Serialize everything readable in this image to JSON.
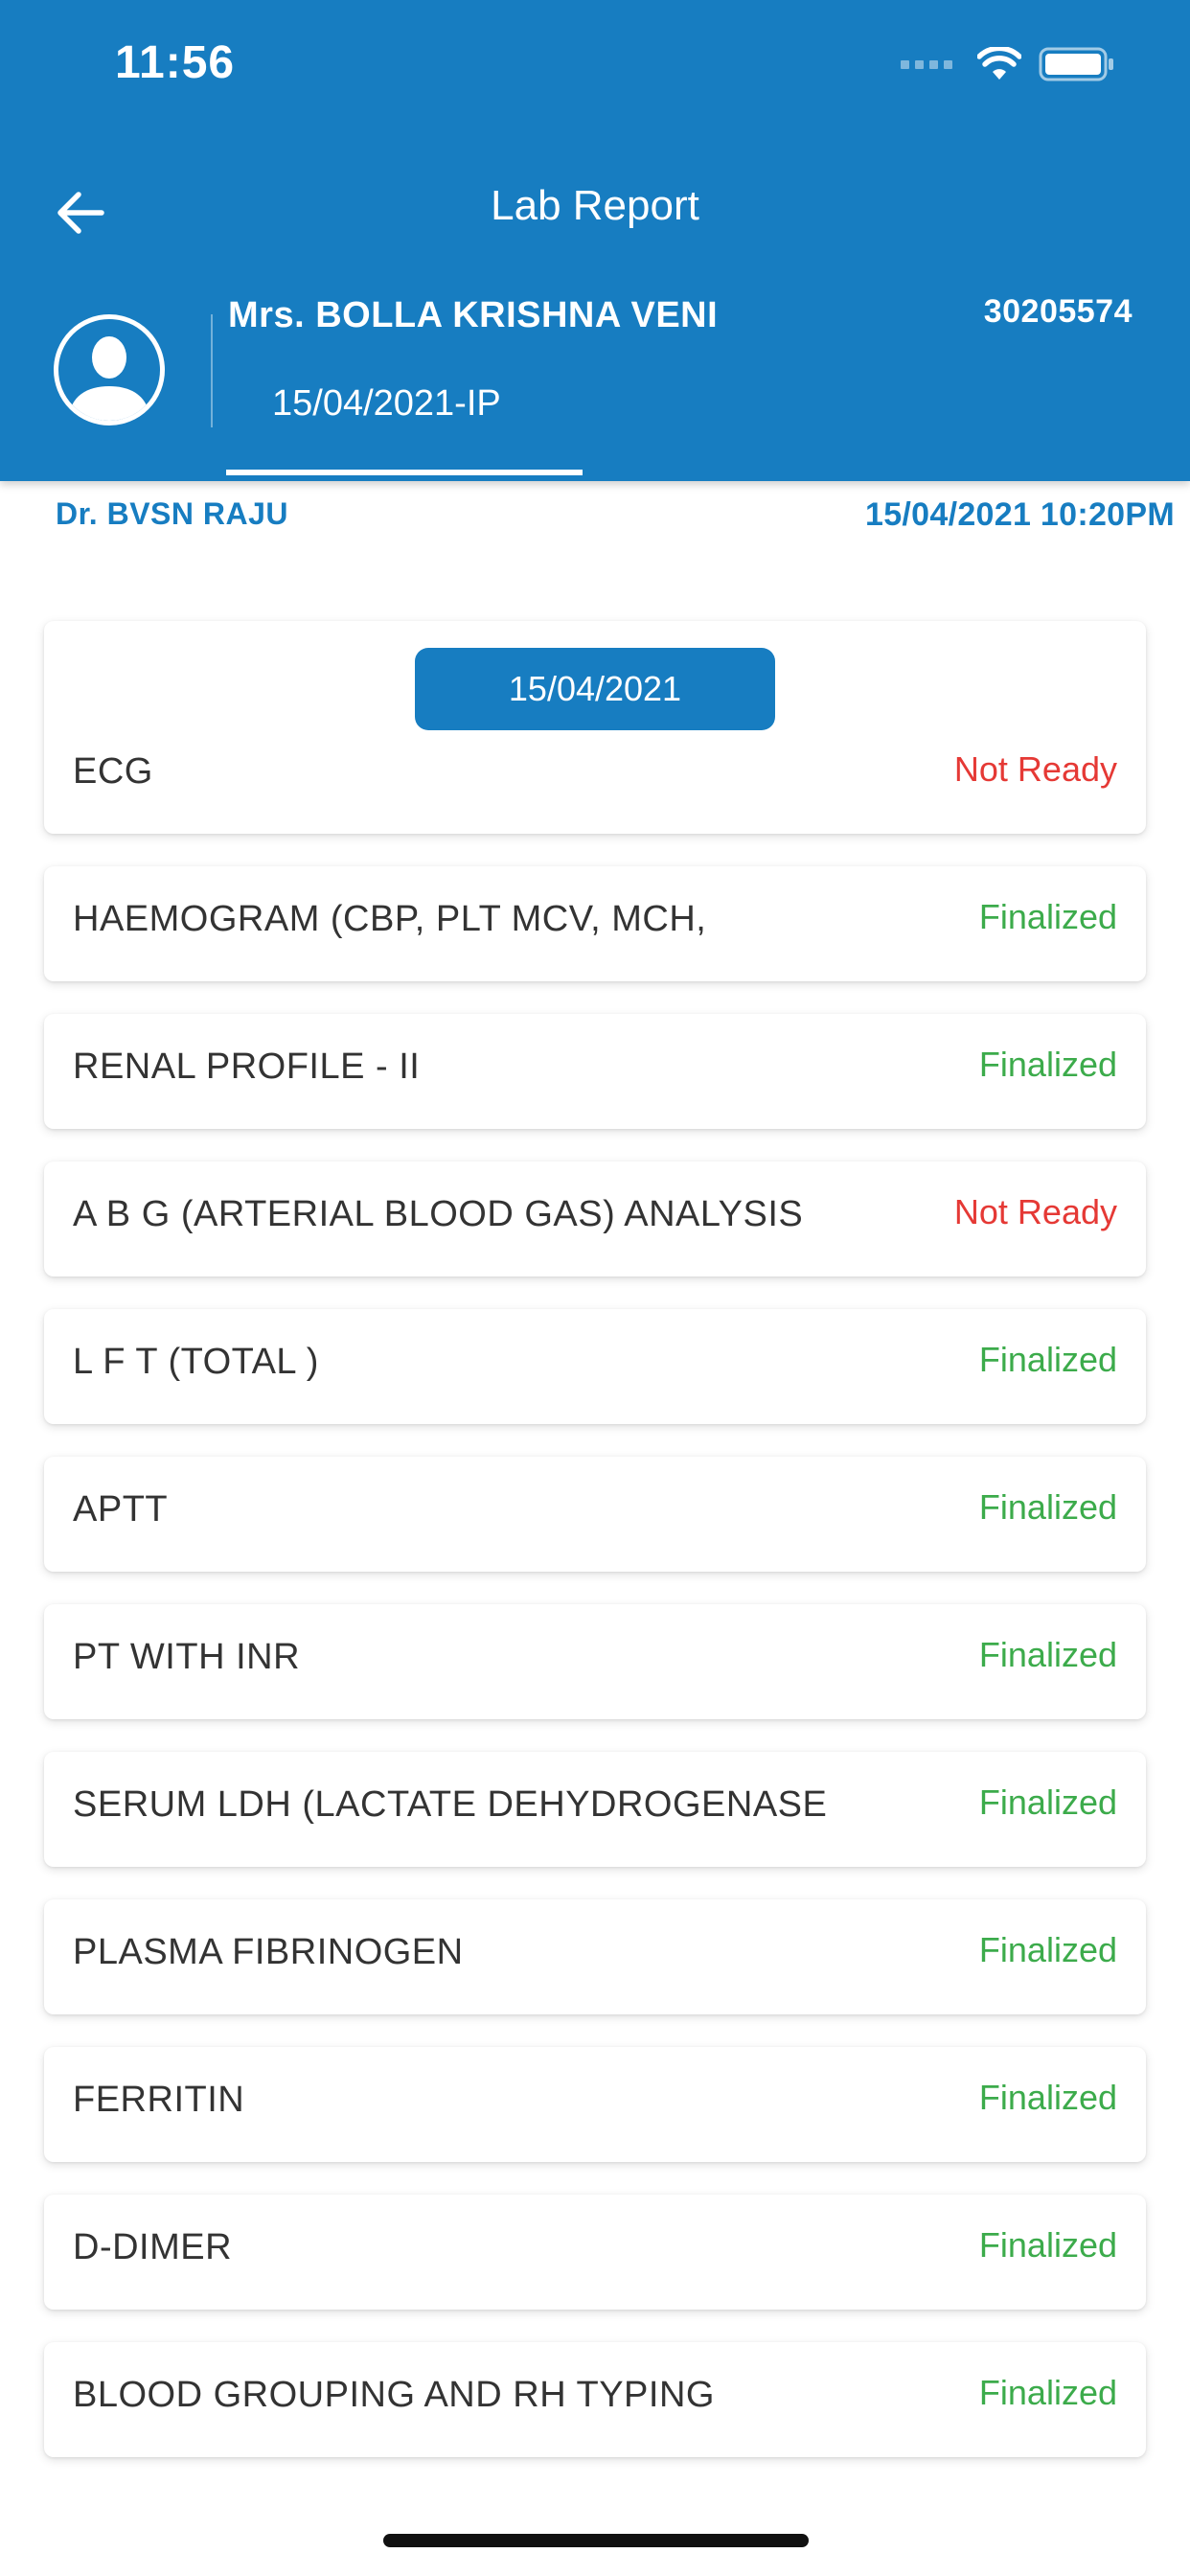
{
  "status_bar": {
    "time": "11:56"
  },
  "header": {
    "title": "Lab Report",
    "patient_name": "Mrs. BOLLA KRISHNA VENI",
    "patient_id": "30205574",
    "visit_tab_label": "15/04/2021-IP"
  },
  "subheader": {
    "doctor": "Dr. BVSN RAJU",
    "datetime": "15/04/2021 10:20PM"
  },
  "date_group": "15/04/2021",
  "colors": {
    "primary": "#177dc1",
    "not_ready": "#e53935",
    "finalized": "#3cab4b"
  },
  "tests": [
    {
      "name": "ECG",
      "status": "Not Ready",
      "state": "not_ready"
    },
    {
      "name": "HAEMOGRAM (CBP, PLT MCV, MCH,",
      "status": "Finalized",
      "state": "finalized"
    },
    {
      "name": "RENAL PROFILE - II",
      "status": "Finalized",
      "state": "finalized"
    },
    {
      "name": "A B G (ARTERIAL BLOOD GAS) ANALYSIS",
      "status": "Not Ready",
      "state": "not_ready"
    },
    {
      "name": "L F T (TOTAL )",
      "status": "Finalized",
      "state": "finalized"
    },
    {
      "name": "APTT",
      "status": "Finalized",
      "state": "finalized"
    },
    {
      "name": "PT WITH INR",
      "status": "Finalized",
      "state": "finalized"
    },
    {
      "name": "SERUM LDH (LACTATE DEHYDROGENASE",
      "status": "Finalized",
      "state": "finalized"
    },
    {
      "name": "PLASMA FIBRINOGEN",
      "status": "Finalized",
      "state": "finalized"
    },
    {
      "name": "FERRITIN",
      "status": "Finalized",
      "state": "finalized"
    },
    {
      "name": "D-DIMER",
      "status": "Finalized",
      "state": "finalized"
    },
    {
      "name": "BLOOD GROUPING AND RH TYPING",
      "status": "Finalized",
      "state": "finalized"
    }
  ]
}
